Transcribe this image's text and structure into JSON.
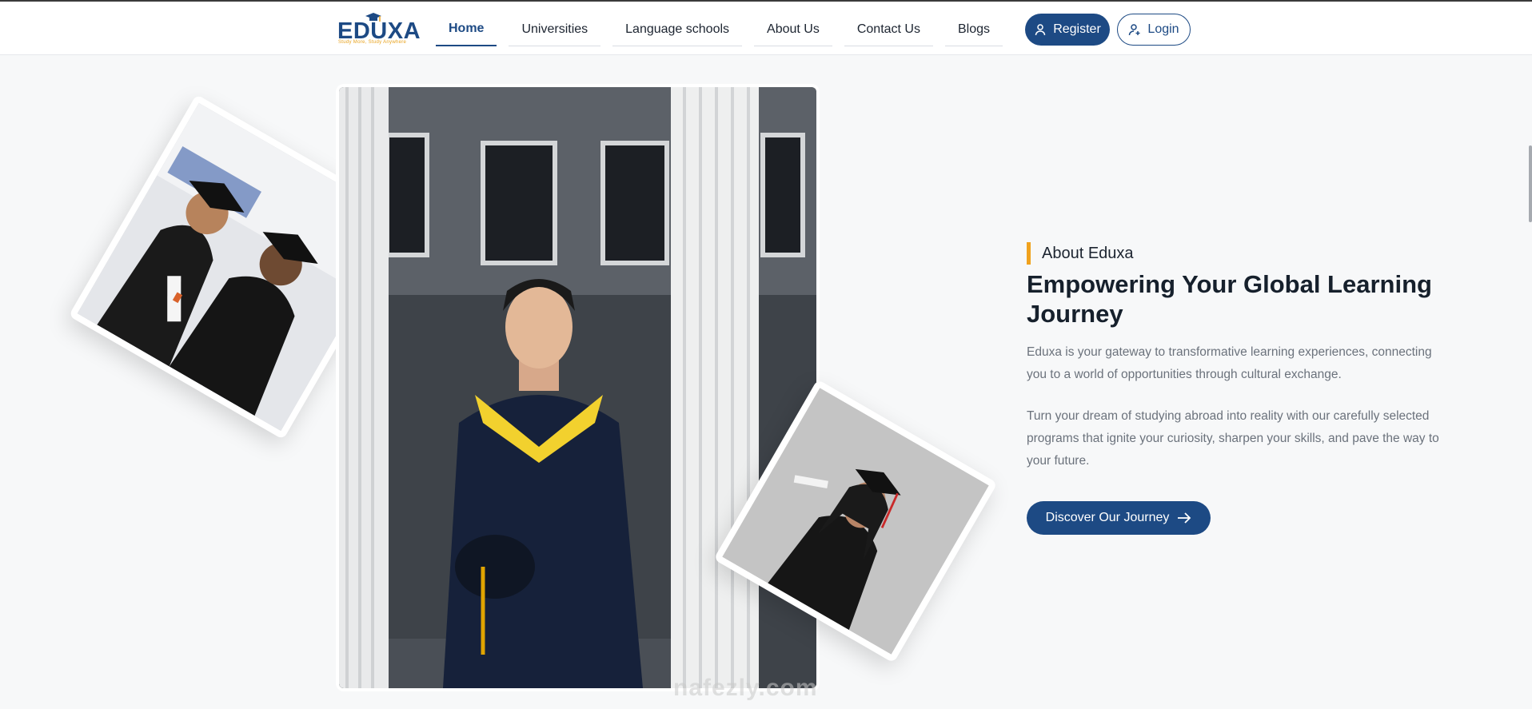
{
  "brand": {
    "name": "EDUXA",
    "tagline": "Study More, Study Anywhere",
    "primary_color": "#1d4a84",
    "accent_color": "#f0a21e"
  },
  "nav": {
    "items": [
      {
        "label": "Home",
        "active": true
      },
      {
        "label": "Universities",
        "active": false
      },
      {
        "label": "Language schools",
        "active": false
      },
      {
        "label": "About Us",
        "active": false
      },
      {
        "label": "Contact Us",
        "active": false
      },
      {
        "label": "Blogs",
        "active": false
      }
    ],
    "register_label": "Register",
    "login_label": "Login",
    "register_icon": "user-icon",
    "login_icon": "user-plus-icon"
  },
  "about": {
    "eyebrow": "About Eduxa",
    "headline": "Empowering Your Global Learning Journey",
    "paragraph_1": "Eduxa is your gateway to transformative learning experiences, connecting you to a world of opportunities through cultural exchange.",
    "paragraph_2": "Turn your dream of studying abroad into reality with our carefully selected programs that ignite your curiosity, sharpen your skills, and pave the way to your future.",
    "cta_label": "Discover Our Journey",
    "cta_icon": "arrow-right-icon"
  },
  "images": {
    "main": "graduate-man-columns-photo",
    "left": "two-graduates-photo",
    "right": "graduate-woman-photo"
  },
  "watermark": "nafezly.com"
}
